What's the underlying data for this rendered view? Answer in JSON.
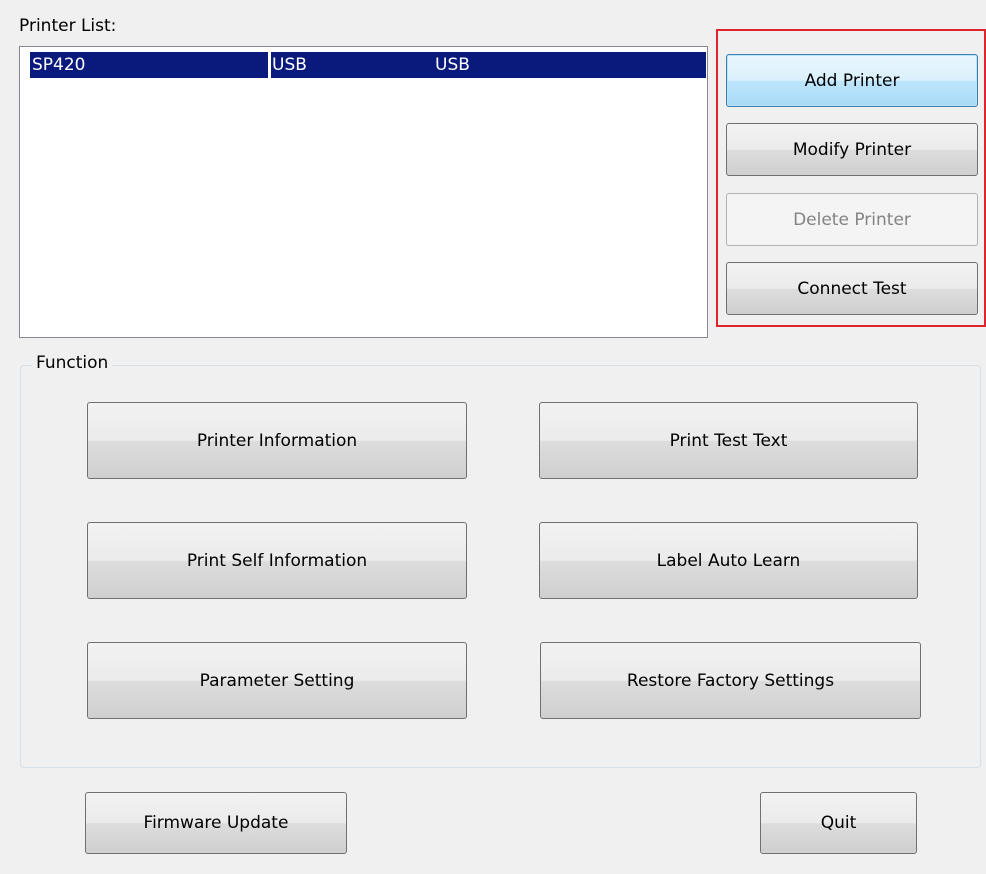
{
  "printer_list": {
    "label": "Printer List:",
    "rows": [
      {
        "name": "SP420",
        "type": "USB",
        "port": "USB",
        "selected": true
      }
    ]
  },
  "printer_actions": {
    "add": "Add Printer",
    "modify": "Modify Printer",
    "delete": "Delete Printer",
    "connect_test": "Connect Test"
  },
  "function": {
    "title": "Function",
    "buttons": {
      "printer_information": "Printer Information",
      "print_test_text": "Print Test Text",
      "print_self_information": "Print Self Information",
      "label_auto_learn": "Label Auto Learn",
      "parameter_setting": "Parameter Setting",
      "restore_factory_settings": "Restore Factory Settings"
    }
  },
  "footer": {
    "firmware_update": "Firmware Update",
    "quit": "Quit"
  },
  "colors": {
    "selection": "#0a1a7c",
    "highlight_border": "#e0242e",
    "default_button": "#bee6fd"
  }
}
